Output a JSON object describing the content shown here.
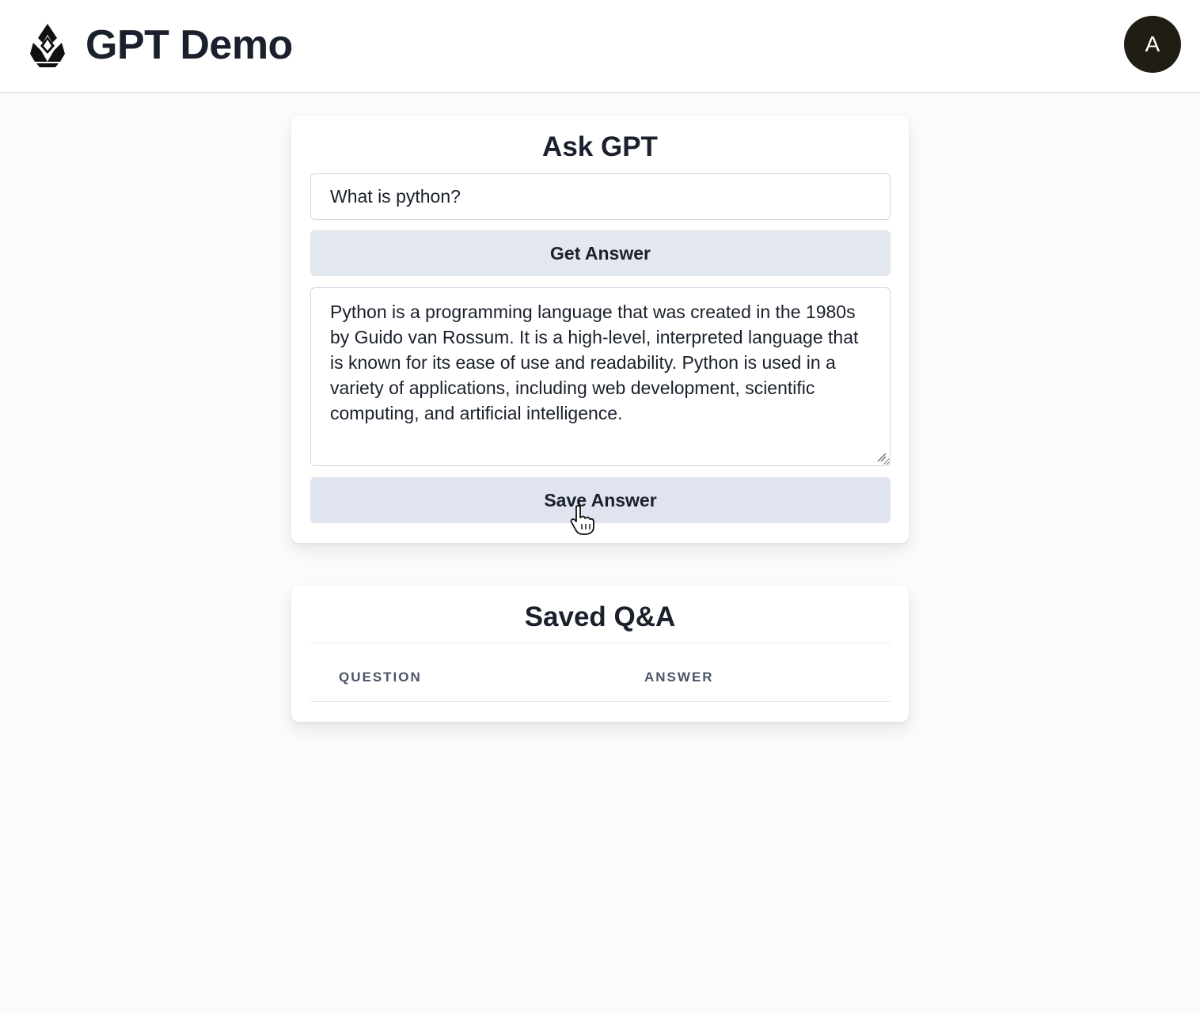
{
  "header": {
    "title": "GPT Demo",
    "logo_icon": "flame-logo-icon",
    "avatar_initial": "A"
  },
  "ask_card": {
    "title": "Ask GPT",
    "question_value": "What is python?",
    "get_answer_label": "Get Answer",
    "answer_value": "Python is a programming language that was created in the 1980s by Guido van Rossum. It is a high-level, interpreted language that is known for its ease of use and readability. Python is used in a variety of applications, including web development, scientific computing, and artificial intelligence.",
    "save_answer_label": "Save Answer"
  },
  "saved_card": {
    "title": "Saved Q&A",
    "columns": [
      "QUESTION",
      "ANSWER"
    ],
    "rows": []
  },
  "colors": {
    "button_bg": "#e3e8ef",
    "avatar_bg": "#1f1d14",
    "text": "#1a202c"
  }
}
